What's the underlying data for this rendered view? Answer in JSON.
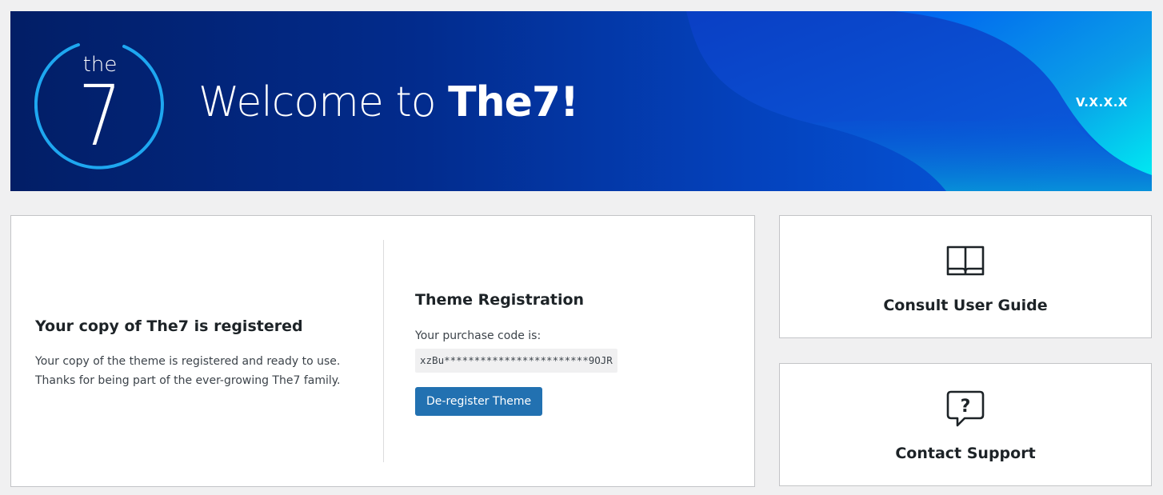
{
  "banner": {
    "logo_small": "the",
    "logo_big": "7",
    "welcome_prefix": "Welcome to ",
    "welcome_brand": "The7!",
    "version": "V.X.X.X",
    "colors": {
      "dark": "#021e66",
      "mid": "#0442bd",
      "bright": "#0760e6",
      "cyan": "#00e5f0",
      "logo_ring": "#1ea7f0"
    }
  },
  "registration": {
    "status_title": "Your copy of The7 is registered",
    "status_text": "Your copy of the theme is registered and ready to use. Thanks for being part of the ever-growing The7 family.",
    "section_title": "Theme Registration",
    "code_label": "Your purchase code is:",
    "code_value": "xzBu************************9OJR",
    "deregister_label": "De-register Theme",
    "button_color": "#2271b1"
  },
  "side": {
    "guide": {
      "label": "Consult User Guide",
      "icon": "book-icon"
    },
    "support": {
      "label": "Contact Support",
      "icon": "question-bubble-icon"
    }
  }
}
